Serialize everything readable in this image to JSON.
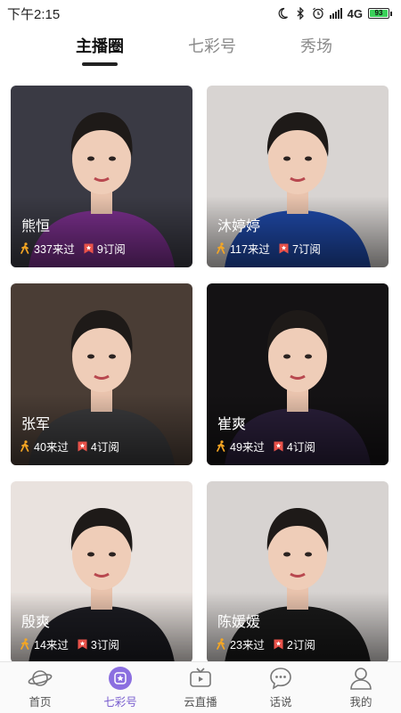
{
  "status_bar": {
    "time": "下午2:15",
    "network": "4G",
    "battery": "93"
  },
  "tabs": [
    {
      "label": "主播圈",
      "active": true
    },
    {
      "label": "七彩号",
      "active": false
    },
    {
      "label": "秀场",
      "active": false
    }
  ],
  "cards": [
    {
      "name": "熊恒",
      "visits": "337来过",
      "subs": "9订阅",
      "bg": "#3a3a44",
      "cloth": "#7a2f8c"
    },
    {
      "name": "沐婷婷",
      "visits": "117来过",
      "subs": "7订阅",
      "bg": "#d8d4d2",
      "cloth": "#1f49a8"
    },
    {
      "name": "张军",
      "visits": "40来过",
      "subs": "4订阅",
      "bg": "#4a3d35",
      "cloth": "#3a3a3c"
    },
    {
      "name": "崔爽",
      "visits": "49来过",
      "subs": "4订阅",
      "bg": "#141214",
      "cloth": "#2a1f3a"
    },
    {
      "name": "殷爽",
      "visits": "14来过",
      "subs": "3订阅",
      "bg": "#e9e2de",
      "cloth": "#1c1c22"
    },
    {
      "name": "陈媛媛",
      "visits": "23来过",
      "subs": "2订阅",
      "bg": "#d7d3d1",
      "cloth": "#1a1a1a"
    }
  ],
  "nav": [
    {
      "label": "首页",
      "icon": "planet-icon",
      "active": false
    },
    {
      "label": "七彩号",
      "icon": "star-badge-icon",
      "active": true
    },
    {
      "label": "云直播",
      "icon": "tv-icon",
      "active": false
    },
    {
      "label": "话说",
      "icon": "chat-bubble-icon",
      "active": false
    },
    {
      "label": "我的",
      "icon": "user-icon",
      "active": false
    }
  ],
  "colors": {
    "accent": "#7a5fcf",
    "walk_icon": "#f5a623",
    "subscribe_icon": "#e8524a"
  }
}
